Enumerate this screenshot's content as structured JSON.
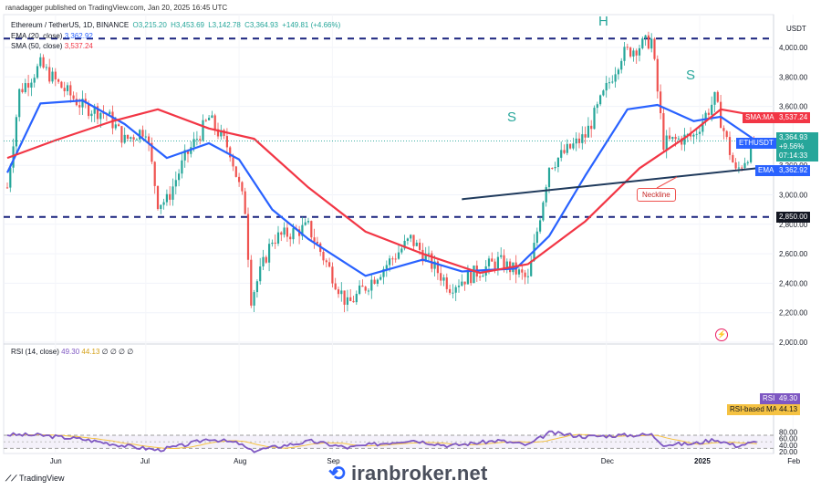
{
  "header": {
    "publisher": "ranadagger published on TradingView.com, Jan 20, 2025 16:45 UTC",
    "symbol": "Ethereum / TetherUS, 1D, BINANCE",
    "open": "O3,215.20",
    "high": "H3,453.69",
    "low": "L3,142.78",
    "close": "C3,364.93",
    "change": "+149.81 (+4.66%)"
  },
  "legend": {
    "ema": "EMA (20, close)",
    "ema_value": "3,362.92",
    "sma": "SMA (50, close)",
    "sma_value": "3,537.24",
    "rsi": "RSI (14, close)",
    "rsi_value": "49.30",
    "rsi_ma_value": "44.13",
    "rsi_extra": "∅ ∅ ∅ ∅"
  },
  "currency": "USDT",
  "badges": {
    "sma_label": "SMA:MA",
    "sma_value": "3,537.24",
    "symbol": "ETHUSDT",
    "price": "3,364.93",
    "change": "+9.56%",
    "timer": "07:14:33",
    "ema_label": "EMA",
    "ema_value": "3,362.92",
    "level": "2,850.00",
    "rsi_label": "RSI",
    "rsi_value": "49.30",
    "rsi_ma_label": "RSI-based MA",
    "rsi_ma_value": "44.13"
  },
  "annotations": {
    "left_shoulder": "S",
    "head": "H",
    "right_shoulder": "S",
    "neckline": "Neckline"
  },
  "footer": {
    "brand": "TradingView",
    "watermark": "iranbroker.net"
  },
  "colors": {
    "up": "#26a69a",
    "down": "#ef5350",
    "ema": "#2962ff",
    "sma": "#f23645",
    "rsi": "#7e57c2",
    "rsi_ma": "#f5c242",
    "level_line": "#1a237e",
    "neckline": "#1f3a5c",
    "label_bg": "#131722"
  },
  "chart_data": {
    "type": "candlestick",
    "x_labels": [
      "Jun",
      "Jul",
      "Aug",
      "Sep",
      "Dec",
      "2025",
      "Feb"
    ],
    "y_ticks": [
      "4,000.00",
      "3,800.00",
      "3,600.00",
      "3,400.00",
      "3,200.00",
      "3,000.00",
      "2,800.00",
      "2,600.00",
      "2,400.00",
      "2,200.00",
      "2,000.00"
    ],
    "ylim": [
      1980,
      4120
    ],
    "horizontal_levels": [
      4060,
      2850
    ],
    "neckline": {
      "from": {
        "x": "Oct 14",
        "y": 2970
      },
      "to": {
        "x": "Jan 20",
        "y": 3180
      }
    },
    "ohlc_path": [
      {
        "x": "May 16",
        "y": 3050
      },
      {
        "x": "May 20",
        "y": 3700
      },
      {
        "x": "May 27",
        "y": 3880
      },
      {
        "x": "Jun 2",
        "y": 3750
      },
      {
        "x": "Jun 10",
        "y": 3600
      },
      {
        "x": "Jun 18",
        "y": 3550
      },
      {
        "x": "Jun 24",
        "y": 3370
      },
      {
        "x": "Jul 1",
        "y": 3450
      },
      {
        "x": "Jul 5",
        "y": 2950
      },
      {
        "x": "Jul 8",
        "y": 2960
      },
      {
        "x": "Jul 14",
        "y": 3250
      },
      {
        "x": "Jul 22",
        "y": 3520
      },
      {
        "x": "Jul 29",
        "y": 3300
      },
      {
        "x": "Aug 3",
        "y": 2900
      },
      {
        "x": "Aug 5",
        "y": 2300
      },
      {
        "x": "Aug 12",
        "y": 2700
      },
      {
        "x": "Aug 24",
        "y": 2780
      },
      {
        "x": "Sep 6",
        "y": 2250
      },
      {
        "x": "Sep 14",
        "y": 2420
      },
      {
        "x": "Sep 27",
        "y": 2700
      },
      {
        "x": "Oct 10",
        "y": 2380
      },
      {
        "x": "Oct 26",
        "y": 2550
      },
      {
        "x": "Nov 1",
        "y": 2480
      },
      {
        "x": "Nov 5",
        "y": 2420
      },
      {
        "x": "Nov 12",
        "y": 3200
      },
      {
        "x": "Nov 24",
        "y": 3400
      },
      {
        "x": "Dec 6",
        "y": 3950
      },
      {
        "x": "Dec 16",
        "y": 4050
      },
      {
        "x": "Dec 20",
        "y": 3350
      },
      {
        "x": "Dec 30",
        "y": 3400
      },
      {
        "x": "Jan 6",
        "y": 3650
      },
      {
        "x": "Jan 13",
        "y": 3150
      },
      {
        "x": "Jan 20",
        "y": 3365
      }
    ],
    "series": [
      {
        "name": "EMA (20, close)",
        "last": 3362.92,
        "values": [
          {
            "x": "May 16",
            "y": 3150
          },
          {
            "x": "May 27",
            "y": 3620
          },
          {
            "x": "Jun 10",
            "y": 3640
          },
          {
            "x": "Jun 24",
            "y": 3480
          },
          {
            "x": "Jul 8",
            "y": 3250
          },
          {
            "x": "Jul 22",
            "y": 3350
          },
          {
            "x": "Aug 1",
            "y": 3240
          },
          {
            "x": "Aug 12",
            "y": 2900
          },
          {
            "x": "Aug 24",
            "y": 2700
          },
          {
            "x": "Sep 12",
            "y": 2450
          },
          {
            "x": "Oct 1",
            "y": 2560
          },
          {
            "x": "Oct 14",
            "y": 2480
          },
          {
            "x": "Nov 1",
            "y": 2500
          },
          {
            "x": "Nov 12",
            "y": 2720
          },
          {
            "x": "Nov 24",
            "y": 3130
          },
          {
            "x": "Dec 8",
            "y": 3580
          },
          {
            "x": "Dec 18",
            "y": 3610
          },
          {
            "x": "Dec 30",
            "y": 3500
          },
          {
            "x": "Jan 8",
            "y": 3530
          },
          {
            "x": "Jan 20",
            "y": 3363
          }
        ]
      },
      {
        "name": "SMA (50, close)",
        "last": 3537.24,
        "values": [
          {
            "x": "May 16",
            "y": 3250
          },
          {
            "x": "Jun 1",
            "y": 3370
          },
          {
            "x": "Jun 20",
            "y": 3500
          },
          {
            "x": "Jul 5",
            "y": 3580
          },
          {
            "x": "Jul 22",
            "y": 3450
          },
          {
            "x": "Aug 6",
            "y": 3380
          },
          {
            "x": "Aug 24",
            "y": 3050
          },
          {
            "x": "Sep 12",
            "y": 2750
          },
          {
            "x": "Oct 1",
            "y": 2600
          },
          {
            "x": "Oct 20",
            "y": 2470
          },
          {
            "x": "Nov 5",
            "y": 2530
          },
          {
            "x": "Nov 24",
            "y": 2820
          },
          {
            "x": "Dec 12",
            "y": 3180
          },
          {
            "x": "Dec 28",
            "y": 3400
          },
          {
            "x": "Jan 8",
            "y": 3580
          },
          {
            "x": "Jan 20",
            "y": 3537
          }
        ]
      }
    ],
    "rsi": {
      "title": "RSI (14, close)",
      "ylim": [
        15,
        85
      ],
      "y_ticks": [
        "80.00",
        "60.00",
        "40.00",
        "20.00"
      ],
      "band": [
        70,
        30
      ],
      "last": 49.3,
      "ma_last": 44.13,
      "values": [
        {
          "x": "May 16",
          "y": 72
        },
        {
          "x": "May 27",
          "y": 70
        },
        {
          "x": "Jun 10",
          "y": 58
        },
        {
          "x": "Jun 24",
          "y": 38
        },
        {
          "x": "Jul 5",
          "y": 25
        },
        {
          "x": "Jul 14",
          "y": 40
        },
        {
          "x": "Jul 22",
          "y": 60
        },
        {
          "x": "Aug 1",
          "y": 45
        },
        {
          "x": "Aug 5",
          "y": 22
        },
        {
          "x": "Aug 18",
          "y": 42
        },
        {
          "x": "Aug 25",
          "y": 52
        },
        {
          "x": "Sep 6",
          "y": 32
        },
        {
          "x": "Sep 27",
          "y": 56
        },
        {
          "x": "Oct 10",
          "y": 38
        },
        {
          "x": "Oct 26",
          "y": 54
        },
        {
          "x": "Nov 5",
          "y": 40
        },
        {
          "x": "Nov 12",
          "y": 78
        },
        {
          "x": "Nov 24",
          "y": 66
        },
        {
          "x": "Dec 6",
          "y": 70
        },
        {
          "x": "Dec 16",
          "y": 72
        },
        {
          "x": "Dec 20",
          "y": 42
        },
        {
          "x": "Dec 30",
          "y": 44
        },
        {
          "x": "Jan 6",
          "y": 58
        },
        {
          "x": "Jan 13",
          "y": 38
        },
        {
          "x": "Jan 20",
          "y": 49.3
        }
      ]
    }
  }
}
